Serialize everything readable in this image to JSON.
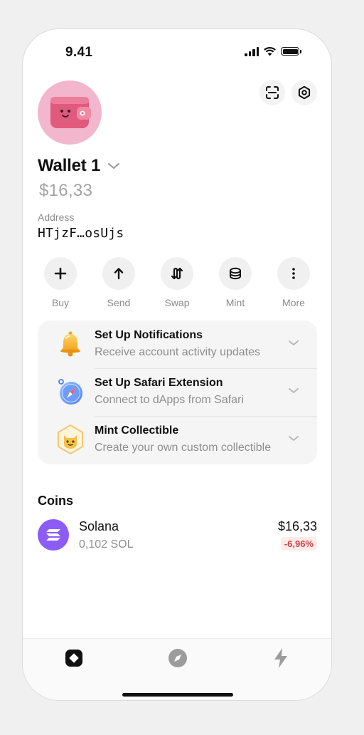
{
  "status_bar": {
    "time": "9.41"
  },
  "wallet": {
    "name": "Wallet 1",
    "balance": "$16,33",
    "address_label": "Address",
    "address": "HTjzF…osUjs"
  },
  "actions": [
    {
      "label": "Buy",
      "icon": "plus-icon"
    },
    {
      "label": "Send",
      "icon": "arrow-up-icon"
    },
    {
      "label": "Swap",
      "icon": "swap-icon"
    },
    {
      "label": "Mint",
      "icon": "coins-icon"
    },
    {
      "label": "More",
      "icon": "more-vertical-icon"
    }
  ],
  "setup_items": [
    {
      "title": "Set Up Notifications",
      "subtitle": "Receive account activity updates",
      "icon": "bell-icon"
    },
    {
      "title": "Set Up Safari Extension",
      "subtitle": "Connect to dApps from Safari",
      "icon": "compass-icon"
    },
    {
      "title": "Mint Collectible",
      "subtitle": "Create your own custom collectible",
      "icon": "cat-badge-icon"
    }
  ],
  "coins": {
    "title": "Coins",
    "items": [
      {
        "name": "Solana",
        "amount": "0,102 SOL",
        "value": "$16,33",
        "change": "-6,96%"
      }
    ]
  },
  "colors": {
    "accent_purple": "#8b5cf6",
    "negative_red": "#d04343",
    "avatar_pink": "#f2b6cd"
  }
}
